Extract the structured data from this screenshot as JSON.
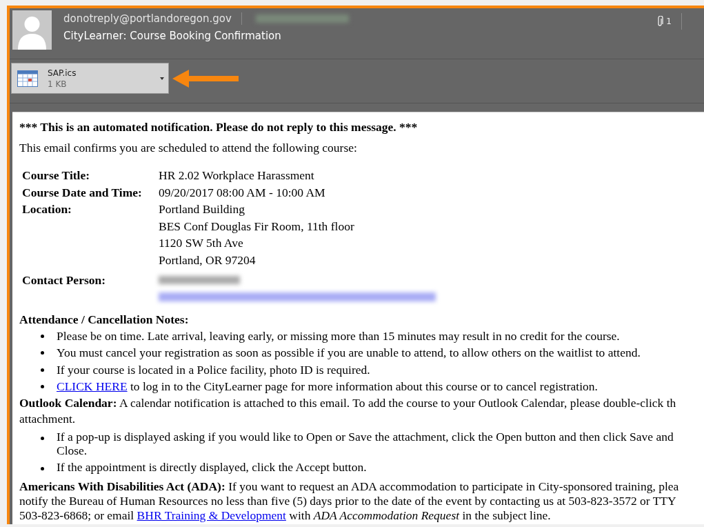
{
  "header": {
    "sender": "donotreply@portlandoregon.gov",
    "subject": "CityLearner: Course Booking Confirmation",
    "attachment_count": "1"
  },
  "attachment": {
    "name": "SAP.ics",
    "size": "1 KB"
  },
  "body": {
    "notice": "*** This is an automated notification. Please do not reply to this message. ***",
    "intro": "This email confirms you are scheduled to attend the following course:",
    "details": [
      {
        "label": "Course Title:",
        "lines": [
          "HR 2.02 Workplace Harassment"
        ]
      },
      {
        "label": "Course Date and Time:",
        "lines": [
          "09/20/2017 08:00 AM - 10:00 AM"
        ]
      },
      {
        "label": "Location:",
        "lines": [
          "Portland Building",
          "BES Conf Douglas Fir Room, 11th floor",
          "1120 SW 5th Ave",
          "Portland, OR 97204"
        ]
      },
      {
        "label": "Contact Person:",
        "kind": "redacted"
      }
    ],
    "notes": {
      "heading": "Attendance / Cancellation Notes:",
      "items": [
        {
          "text": "Please be on time. Late arrival, leaving early, or missing more than 15 minutes may result in no credit for the course."
        },
        {
          "text": "You must cancel your registration as soon as possible if you are unable to attend, to allow others on the waitlist to attend."
        },
        {
          "text": "If your course is located in a Police facility, photo ID is required."
        },
        {
          "link": "CLICK HERE",
          "text": " to log in to the CityLearner page for more information about this course or to cancel registration."
        }
      ]
    },
    "outlook": {
      "heading": "Outlook Calendar:",
      "lines": [
        " A calendar notification is attached to this email. To add the course to your Outlook Calendar, please double-click th",
        "attachment."
      ],
      "items": [
        {
          "text": "If a pop-up is displayed asking if you would like to Open or Save the attachment, click the Open button and then click Save and Close."
        },
        {
          "text": "If the appointment is directly displayed, click the Accept button."
        }
      ]
    },
    "ada": {
      "heading": "Americans With Disabilities Act (ADA):",
      "lines": [
        " If you want to request an ADA accommodation to participate in City-sponsored training, plea",
        "notify the Bureau of Human Resources no less than five (5) days prior to the date of the event by contacting us at 503-823-3572 or TTY"
      ],
      "last_before": "503-823-6868; or email ",
      "link": "BHR Training & Development",
      "last_after": " with *ADA Accommodation Request* in the subject line."
    }
  }
}
